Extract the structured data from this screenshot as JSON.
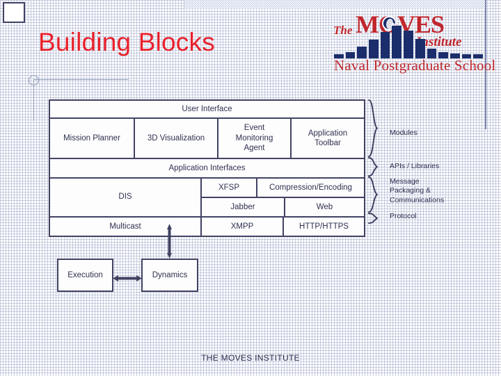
{
  "slide": {
    "title": "Building Blocks",
    "title_color": "#e8212c",
    "footer": "THE MOVES INSTITUTE",
    "line_color": "#414263",
    "text_color": "#2f3050"
  },
  "logo": {
    "the": "The",
    "moves": "MOVES",
    "institute": "Institute",
    "school": "Naval Postgraduate School",
    "red": "#c0272d",
    "navy": "#1b2d6b",
    "bars": [
      6,
      9,
      17,
      27,
      38,
      47,
      40,
      28,
      14,
      9,
      7,
      6,
      6
    ]
  },
  "diagram": {
    "rows": {
      "user_interface": {
        "label": "User Interface"
      },
      "modules": [
        {
          "label": "Mission Planner"
        },
        {
          "label": "3D Visualization"
        },
        {
          "label": "Event\nMonitoring\nAgent"
        },
        {
          "label": "Application\nToolbar"
        }
      ],
      "application_interfaces": {
        "label": "Application Interfaces"
      },
      "dis": {
        "label": "DIS"
      },
      "dis_sub_top": [
        {
          "label": "XFSP"
        },
        {
          "label": "Compression/Encoding"
        }
      ],
      "dis_sub_bottom": [
        {
          "label": "Jabber"
        },
        {
          "label": "Web"
        }
      ],
      "multicast": [
        {
          "label": "Multicast"
        },
        {
          "label": "XMPP"
        },
        {
          "label": "HTTP/HTTPS"
        }
      ]
    },
    "brace_labels": [
      {
        "label": "Modules"
      },
      {
        "label": "APIs / Libraries"
      },
      {
        "label": "Message\nPackaging &\nCommunications"
      },
      {
        "label": "Protocol"
      }
    ],
    "bottom_boxes": {
      "execution": {
        "label": "Execution"
      },
      "dynamics": {
        "label": "Dynamics"
      }
    }
  }
}
